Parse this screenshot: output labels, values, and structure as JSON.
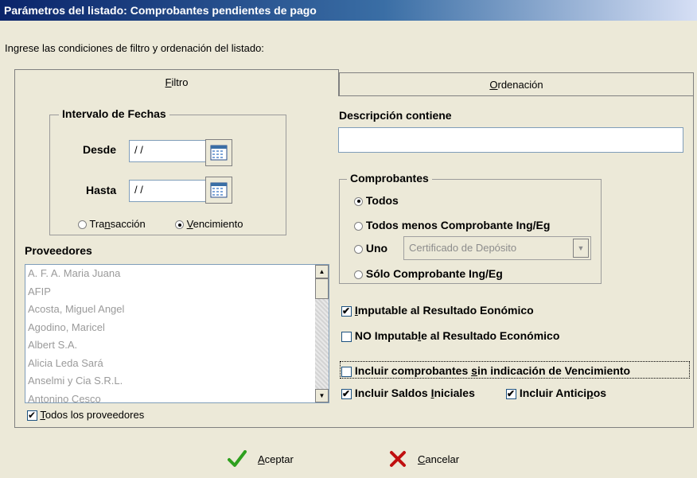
{
  "window": {
    "title": "Parámetros del listado: Comprobantes pendientes de pago"
  },
  "instructions": "Ingrese las condiciones de filtro y ordenación del listado:",
  "tabs": [
    {
      "pre": "",
      "accel": "F",
      "post": "iltro",
      "active": true
    },
    {
      "pre": "",
      "accel": "O",
      "post": "rdenación",
      "active": false
    }
  ],
  "fechas": {
    "legend": "Intervalo de Fechas",
    "desde_label": "Desde",
    "desde_value": " / /",
    "hasta_label": "Hasta",
    "hasta_value": " / /",
    "radio_transaccion": {
      "pre": "Tra",
      "accel": "n",
      "post": "sacción",
      "selected": false
    },
    "radio_vencimiento": {
      "pre": "",
      "accel": "V",
      "post": "encimiento",
      "selected": true
    }
  },
  "proveedores": {
    "label": "Proveedores",
    "items": [
      "A. F. A. Maria Juana",
      "AFIP",
      "Acosta, Miguel Angel",
      "Agodino, Maricel",
      "Albert S.A.",
      "Alicia Leda Sará",
      "Anselmi y Cia S.R.L.",
      "Antonino Cesco"
    ],
    "todos": {
      "pre": "",
      "accel": "T",
      "post": "odos los proveedores",
      "checked": true
    }
  },
  "descripcion": {
    "label": "Descripción contiene",
    "value": ""
  },
  "comprobantes": {
    "legend": "Comprobantes",
    "todos": {
      "label": "Todos",
      "selected": true
    },
    "todos_menos": {
      "label": "Todos menos Comprobante Ing/Eg",
      "selected": false
    },
    "uno": {
      "label": "Uno",
      "selected": false,
      "select_value": "Certificado de Depósito"
    },
    "solo": {
      "label": "Sólo Comprobante Ing/Eg",
      "selected": false
    }
  },
  "checks": {
    "imputable": {
      "pre": "",
      "accel": "I",
      "post": "mputable al Resultado Eonómico",
      "checked": true
    },
    "no_imputable": {
      "pre": "NO Imputab",
      "accel": "l",
      "post": "e al Resultado Económico",
      "checked": false
    },
    "sin_vencimiento": {
      "pre": "Incluir comprobantes ",
      "accel": "s",
      "post": "in indicación de Vencimiento",
      "checked": false
    },
    "saldos": {
      "pre": "Incluir Saldos ",
      "accel": "I",
      "post": "niciales",
      "checked": true
    },
    "anticipos": {
      "pre": "Incluir Antici",
      "accel": "p",
      "post": "os",
      "checked": true
    }
  },
  "buttons": {
    "aceptar": {
      "pre": "",
      "accel": "A",
      "post": "ceptar"
    },
    "cancelar": {
      "pre": "",
      "accel": "C",
      "post": "ancelar"
    }
  },
  "colors": {
    "accept": "#2ea01e",
    "cancel": "#c01010",
    "titlebar": "#0a246a"
  },
  "icons": {
    "calendar": "calendar-icon",
    "accept": "checkmark-icon",
    "cancel": "x-icon"
  }
}
